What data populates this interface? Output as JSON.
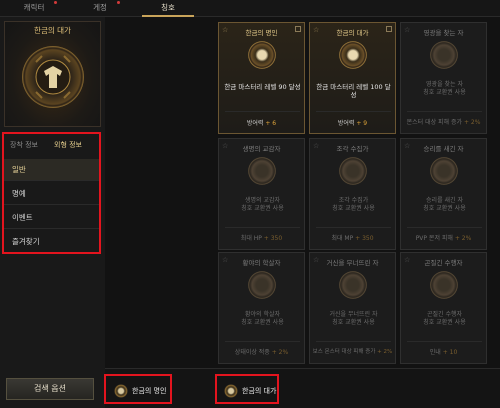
{
  "tabs": [
    {
      "label": "캐릭터"
    },
    {
      "label": "게정"
    },
    {
      "label": "칭호"
    }
  ],
  "left": {
    "emblem_title": "한금의 대가",
    "subtabs": [
      "장착 정보",
      "외형 정보"
    ],
    "categories": [
      "일반",
      "명예",
      "이벤트",
      "즐겨찾기"
    ],
    "search_button": "검색 옵션"
  },
  "bottom_slots": [
    {
      "label": "한금의 명인"
    },
    {
      "label": "한금의 대가"
    }
  ],
  "cards": [
    {
      "title": "한금의 명인",
      "desc": "한금 마스터리 레벨 90 달성",
      "stat": "방어력",
      "value": "+ 6",
      "owned": true
    },
    {
      "title": "한금의 대가",
      "desc": "한금 마스터리 레벨 100 달성",
      "stat": "방어력",
      "value": "+ 9",
      "owned": true
    },
    {
      "title": "영광을 찾는 자",
      "desc": "영광을 찾는 자\n칭호 교환권 사용",
      "stat": "몬스터 대상 피해 증가",
      "value": "+ 2%",
      "owned": false
    },
    {
      "title": "생명의 교감자",
      "desc": "생명의 교감자\n칭호 교환권 사용",
      "stat": "최대 HP",
      "value": "+ 350",
      "owned": false
    },
    {
      "title": "조각 수집가",
      "desc": "조각 수집가\n칭호 교환권 사용",
      "stat": "최대 MP",
      "value": "+ 350",
      "owned": false
    },
    {
      "title": "승리를 새긴 자",
      "desc": "승리를 새긴 자\n칭호 교환권 사용",
      "stat": "PVP 몬저 피해",
      "value": "+ 2%",
      "owned": false
    },
    {
      "title": "황야의 학살자",
      "desc": "황야의 학살자\n칭호 교환권 사용",
      "stat": "상태이상 적중",
      "value": "+ 2%",
      "owned": false
    },
    {
      "title": "거신을 무너뜨린 자",
      "desc": "거신을 무너뜨린 자\n칭호 교환권 사용",
      "stat": "보스 몬스터 대상 피해 증가",
      "value": "+ 2%",
      "owned": false
    },
    {
      "title": "곤질긴 수행자",
      "desc": "곤질긴 수행자\n칭호 교환권 사용",
      "stat": "인내",
      "value": "+ 10",
      "owned": false
    }
  ]
}
